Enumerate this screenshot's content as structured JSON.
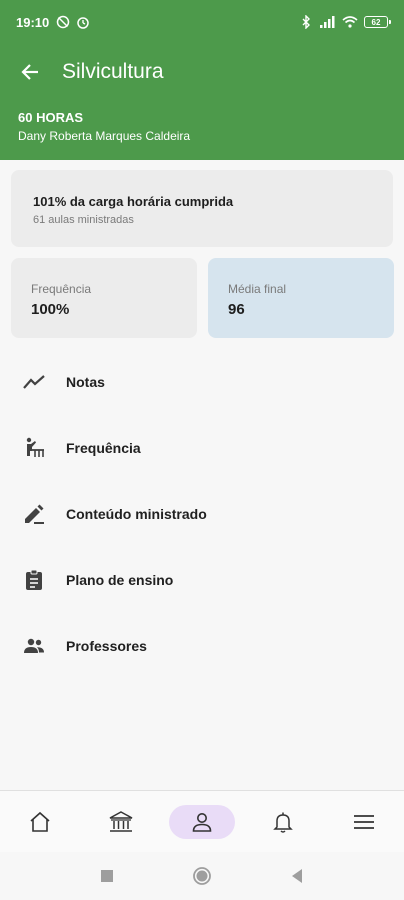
{
  "status_bar": {
    "time": "19:10",
    "battery": "62"
  },
  "app_bar": {
    "title": "Silvicultura"
  },
  "course": {
    "hours": "60 HORAS",
    "teacher": "Dany Roberta Marques Caldeira"
  },
  "workload_card": {
    "main": "101% da carga horária cumprida",
    "sub": "61 aulas ministradas"
  },
  "attendance_card": {
    "label": "Frequência",
    "value": "100%"
  },
  "final_grade_card": {
    "label": "Média final",
    "value": "96"
  },
  "menu": {
    "items": [
      {
        "label": "Notas",
        "icon": "trending-line-icon"
      },
      {
        "label": "Frequência",
        "icon": "attendance-icon"
      },
      {
        "label": "Conteúdo ministrado",
        "icon": "edit-pen-icon"
      },
      {
        "label": "Plano de ensino",
        "icon": "clipboard-icon"
      },
      {
        "label": "Professores",
        "icon": "people-icon"
      }
    ]
  },
  "bottom_nav": {
    "items": [
      {
        "icon": "home-icon",
        "active": false
      },
      {
        "icon": "institution-icon",
        "active": false
      },
      {
        "icon": "person-icon",
        "active": true
      },
      {
        "icon": "bell-icon",
        "active": false
      },
      {
        "icon": "menu-icon",
        "active": false
      }
    ]
  },
  "colors": {
    "header_green": "#4d9a4b",
    "grade_card_blue": "#d6e4ee",
    "active_nav_purple": "#e9dcf7"
  }
}
